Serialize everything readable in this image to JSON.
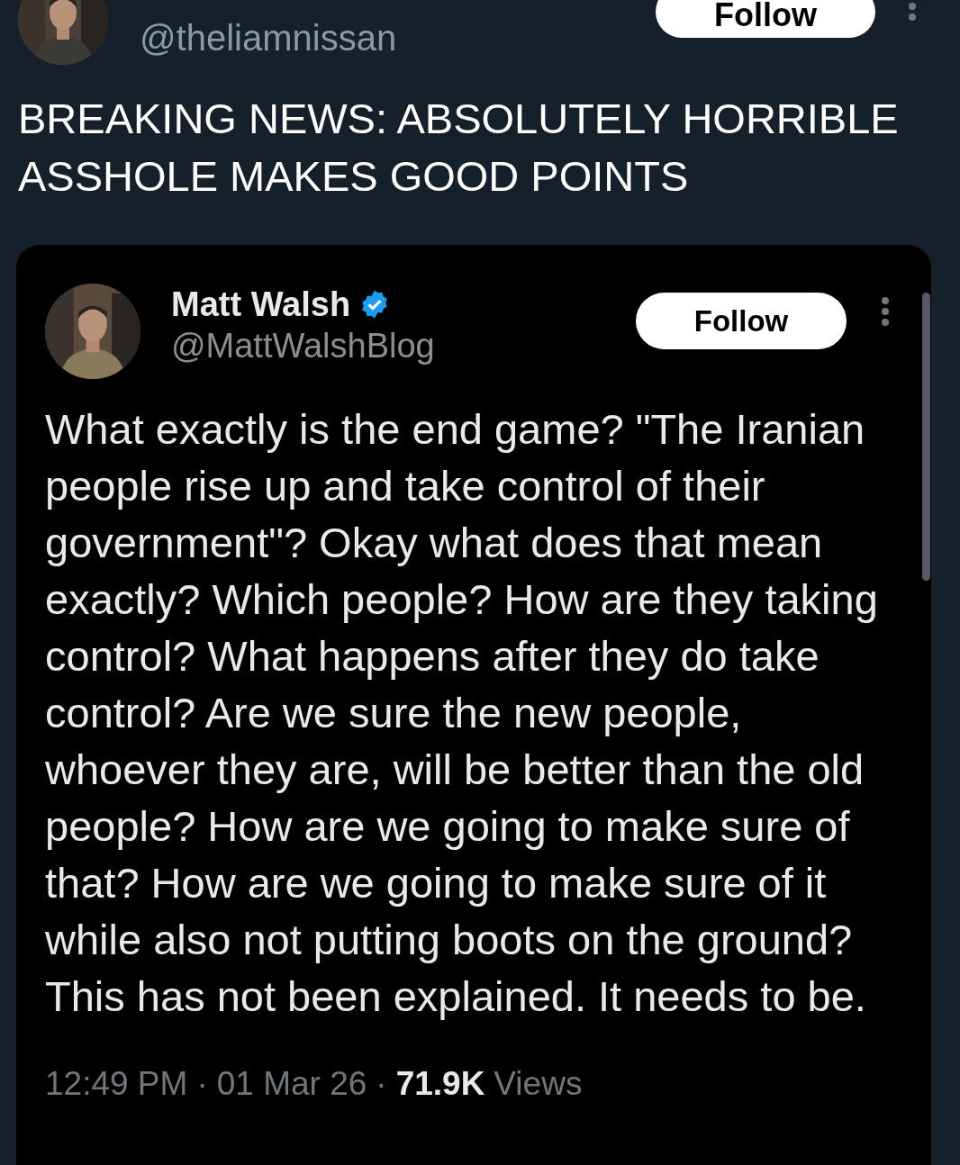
{
  "author": {
    "handle": "@theliamnissan",
    "follow_label": "Follow"
  },
  "post_text": "BREAKING NEWS: ABSOLUTELY HORRIBLE ASSHOLE MAKES GOOD POINTS",
  "quoted": {
    "name": "Matt Walsh",
    "verified": true,
    "handle": "@MattWalshBlog",
    "follow_label": "Follow",
    "text": "What exactly is the end game? \"The Iranian people rise up and take control of their government\"? Okay what does that mean exactly? Which people? How are they taking control? What happens after they do take control? Are we sure the new people, whoever they are, will be better than the old people? How are we going to make sure of that? How are we going to make sure of it while also not putting boots on the ground? This has not been explained. It needs to be.",
    "meta": [
      {
        "kind": "plain",
        "text": "12:49 PM"
      },
      {
        "kind": "sep",
        "text": "·"
      },
      {
        "kind": "plain",
        "text": "01 Mar 26"
      },
      {
        "kind": "sep",
        "text": "·"
      },
      {
        "kind": "bold",
        "text": "71.9K"
      },
      {
        "kind": "plain",
        "text": "Views"
      }
    ]
  }
}
